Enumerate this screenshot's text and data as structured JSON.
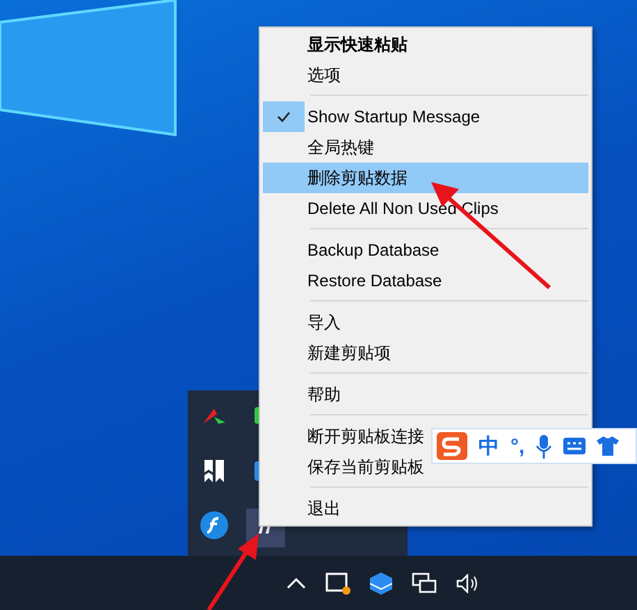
{
  "context_menu": {
    "items": [
      {
        "kind": "item",
        "label": "显示快速粘贴",
        "default": true,
        "checked": false,
        "selected": false
      },
      {
        "kind": "item",
        "label": "选项",
        "default": false,
        "checked": false,
        "selected": false
      },
      {
        "kind": "separator"
      },
      {
        "kind": "item",
        "label": "Show Startup Message",
        "default": false,
        "checked": true,
        "selected": false
      },
      {
        "kind": "item",
        "label": "全局热键",
        "default": false,
        "checked": false,
        "selected": false
      },
      {
        "kind": "item",
        "label": "删除剪贴数据",
        "default": false,
        "checked": false,
        "selected": true
      },
      {
        "kind": "item",
        "label": "Delete All Non Used Clips",
        "default": false,
        "checked": false,
        "selected": false
      },
      {
        "kind": "separator"
      },
      {
        "kind": "item",
        "label": "Backup Database",
        "default": false,
        "checked": false,
        "selected": false
      },
      {
        "kind": "item",
        "label": "Restore Database",
        "default": false,
        "checked": false,
        "selected": false
      },
      {
        "kind": "separator"
      },
      {
        "kind": "item",
        "label": "导入",
        "default": false,
        "checked": false,
        "selected": false
      },
      {
        "kind": "item",
        "label": "新建剪贴项",
        "default": false,
        "checked": false,
        "selected": false
      },
      {
        "kind": "separator"
      },
      {
        "kind": "item",
        "label": "帮助",
        "default": false,
        "checked": false,
        "selected": false
      },
      {
        "kind": "separator"
      },
      {
        "kind": "item",
        "label": "断开剪贴板连接",
        "default": false,
        "checked": false,
        "selected": false
      },
      {
        "kind": "item",
        "label": "保存当前剪贴板",
        "default": false,
        "checked": false,
        "selected": false
      },
      {
        "kind": "separator"
      },
      {
        "kind": "item",
        "label": "退出",
        "default": false,
        "checked": false,
        "selected": false
      }
    ]
  },
  "ime_toolbar": {
    "mode": "中",
    "punctuation": "°,"
  },
  "tray_overflow": {
    "icons": [
      {
        "kind": "arrows",
        "selected": false
      },
      {
        "kind": "green",
        "selected": false
      },
      {
        "kind": "bookmark",
        "selected": false
      },
      {
        "kind": "blue",
        "selected": false
      },
      {
        "kind": "flash",
        "selected": false
      },
      {
        "kind": "quote",
        "selected": true
      }
    ]
  }
}
